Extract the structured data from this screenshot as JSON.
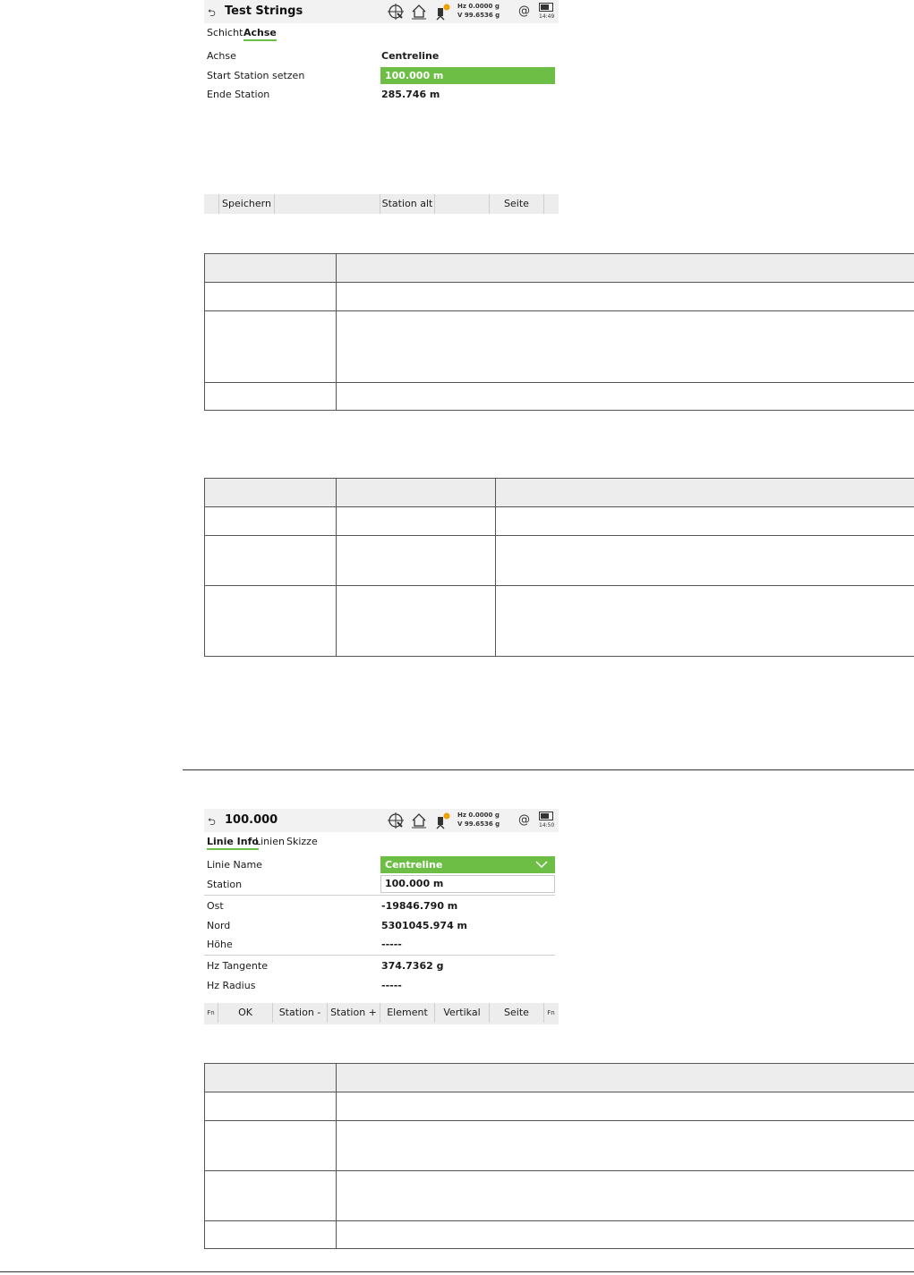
{
  "screen1": {
    "back_icon": "back-arrow-icon",
    "title": "Test Strings",
    "hz": "Hz 0.0000 g",
    "v": "V   99.6536 g",
    "at": "@",
    "time": "14:49",
    "tabs": [
      "Schicht",
      "Achse"
    ],
    "rows": [
      {
        "label": "Achse",
        "value": "Centreline"
      },
      {
        "label": "Start Station setzen",
        "value": "100.000 m"
      },
      {
        "label": "Ende Station",
        "value": "285.746 m"
      }
    ],
    "softkeys": [
      "Speichern",
      "Station alt",
      "Seite"
    ]
  },
  "screen2": {
    "title": "100.000",
    "hz": "Hz 0.0000 g",
    "v": "V   99.6536 g",
    "at": "@",
    "time": "14:50",
    "tabs": [
      "Linie Info",
      "Linien",
      "Skizze"
    ],
    "rows": [
      {
        "label": "Linie Name",
        "value": "Centreline"
      },
      {
        "label": "Station",
        "value": "100.000 m"
      },
      {
        "label": "Ost",
        "value": "-19846.790 m"
      },
      {
        "label": "Nord",
        "value": "5301045.974 m"
      },
      {
        "label": "Höhe",
        "value": "-----"
      },
      {
        "label": "Hz Tangente",
        "value": "374.7362 g"
      },
      {
        "label": "Hz Radius",
        "value": "-----"
      }
    ],
    "fn": "Fn",
    "softkeys": [
      "OK",
      "Station -",
      "Station +",
      "Element",
      "Vertikal",
      "Seite"
    ]
  }
}
